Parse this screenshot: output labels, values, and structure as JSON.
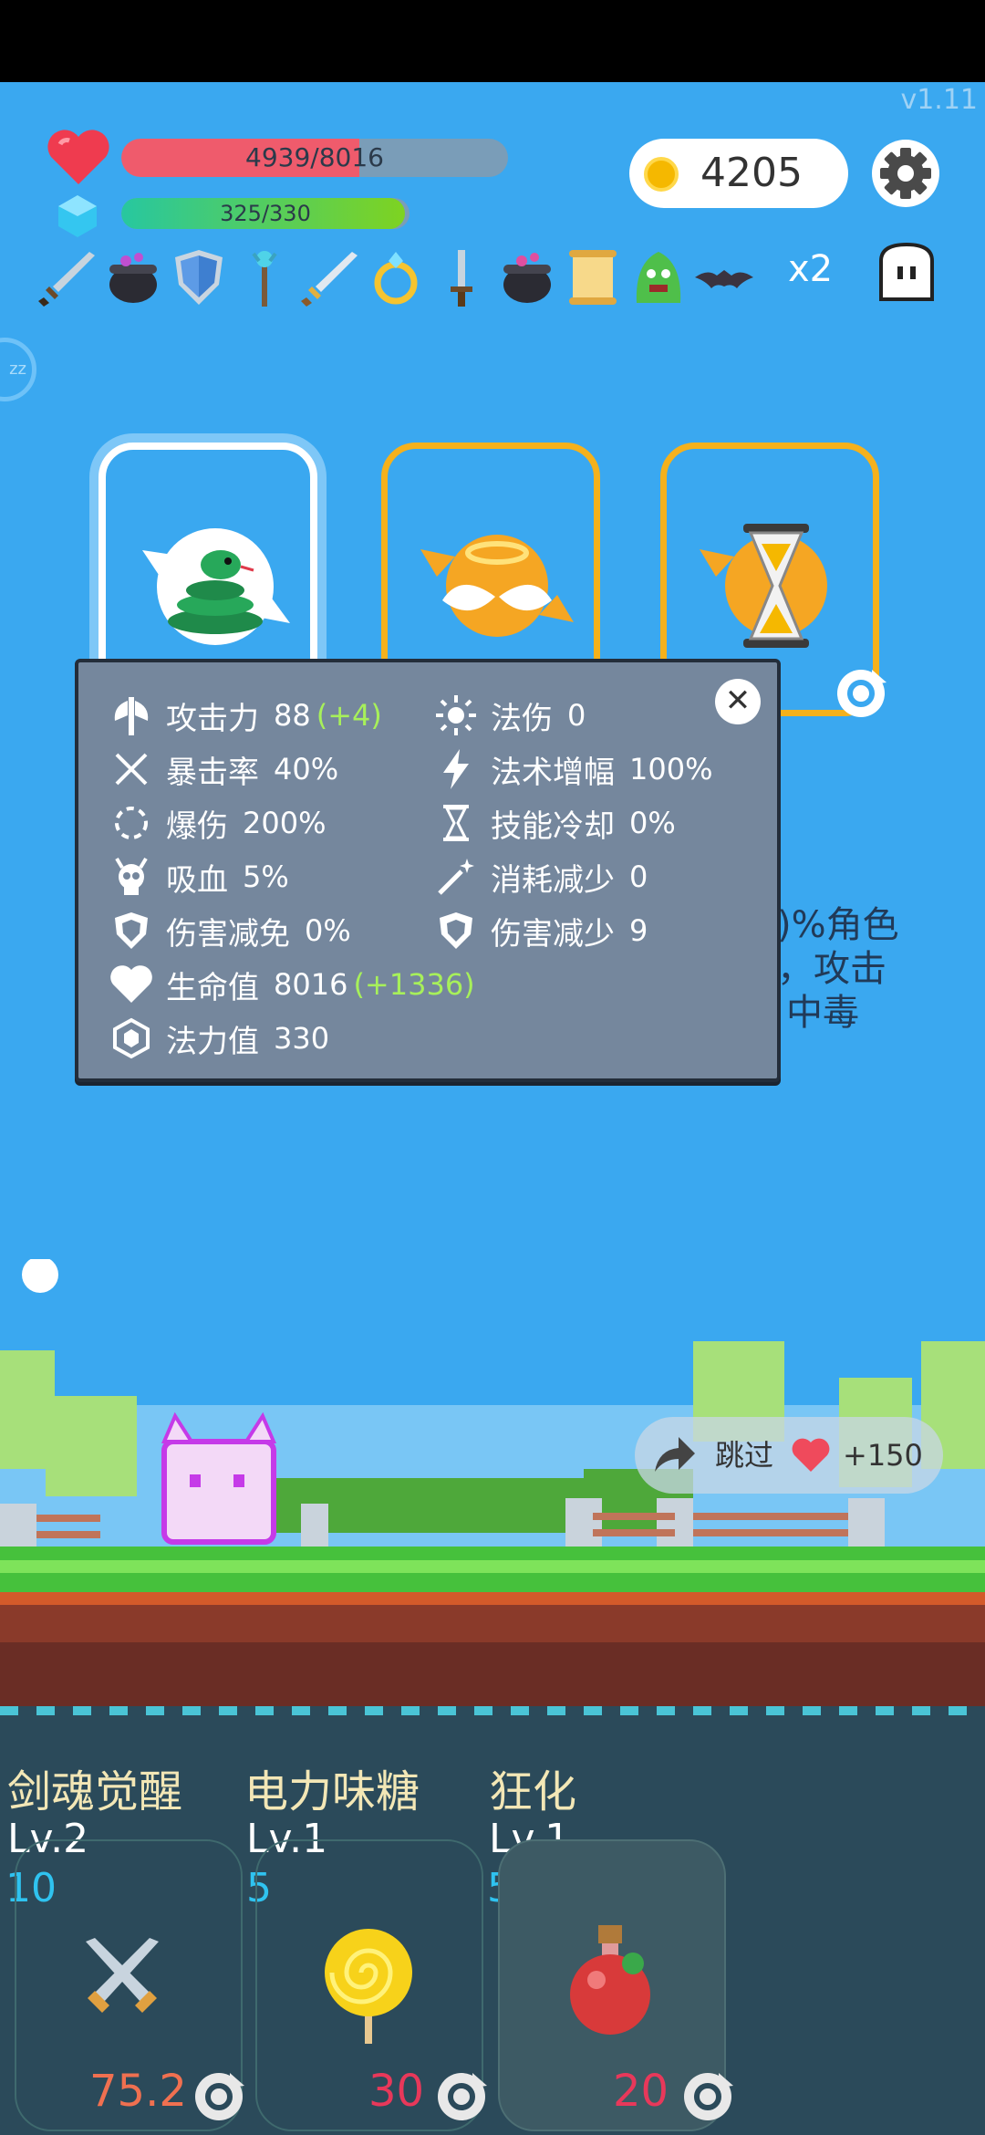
{
  "version": "v1.11",
  "hud": {
    "hp_text": "4939/8016",
    "hp_fraction": 0.616,
    "mp_text": "325/330",
    "mp_fraction": 0.985,
    "gold": "4205",
    "multiplier": "x2"
  },
  "inventory": [
    "sword-icon",
    "cauldron-icon",
    "shield-icon",
    "staff-icon",
    "sword-icon",
    "ring-icon",
    "dagger-icon",
    "cauldron-icon",
    "scroll-icon",
    "slime-icon",
    "bat-icon"
  ],
  "cards": [
    {
      "icon": "snake-icon",
      "selected": true
    },
    {
      "icon": "angel-halo-icon",
      "selected": false
    },
    {
      "icon": "hourglass-icon",
      "selected": false
    }
  ],
  "behind_text": {
    "line1": ")%角色",
    "line2": "，攻击",
    "line3": "中毒"
  },
  "stats": {
    "attack": {
      "label": "攻击力",
      "value": "88",
      "bonus": "(+4)"
    },
    "crit_rate": {
      "label": "暴击率",
      "value": "40%"
    },
    "crit_damage": {
      "label": "爆伤",
      "value": "200%"
    },
    "lifesteal": {
      "label": "吸血",
      "value": "5%"
    },
    "damage_immunity": {
      "label": "伤害减免",
      "value": "0%"
    },
    "hp": {
      "label": "生命值",
      "value": "8016",
      "bonus": "(+1336)"
    },
    "mp": {
      "label": "法力值",
      "value": "330"
    },
    "magic_damage": {
      "label": "法伤",
      "value": "0"
    },
    "spell_amp": {
      "label": "法术增幅",
      "value": "100%"
    },
    "cooldown": {
      "label": "技能冷却",
      "value": "0%"
    },
    "cost_reduction": {
      "label": "消耗减少",
      "value": "0"
    },
    "damage_reduction": {
      "label": "伤害减少",
      "value": "9"
    },
    "close_glyph": "✕"
  },
  "skip": {
    "label": "跳过",
    "reward": "+150"
  },
  "skills": [
    {
      "name": "剑魂觉醒",
      "level": "Lv.2",
      "cost": "10",
      "cooldown": "75.2",
      "cooldown_color": "#f07050",
      "icon": "crossed-swords-icon"
    },
    {
      "name": "电力味糖",
      "level": "Lv.1",
      "cost": "5",
      "cooldown": "30",
      "cooldown_color": "#e8385a",
      "icon": "lollipop-icon"
    },
    {
      "name": "狂化",
      "level": "Lv.1",
      "cost": "5",
      "cooldown": "20",
      "cooldown_color": "#e8385a",
      "icon": "potion-icon"
    }
  ]
}
